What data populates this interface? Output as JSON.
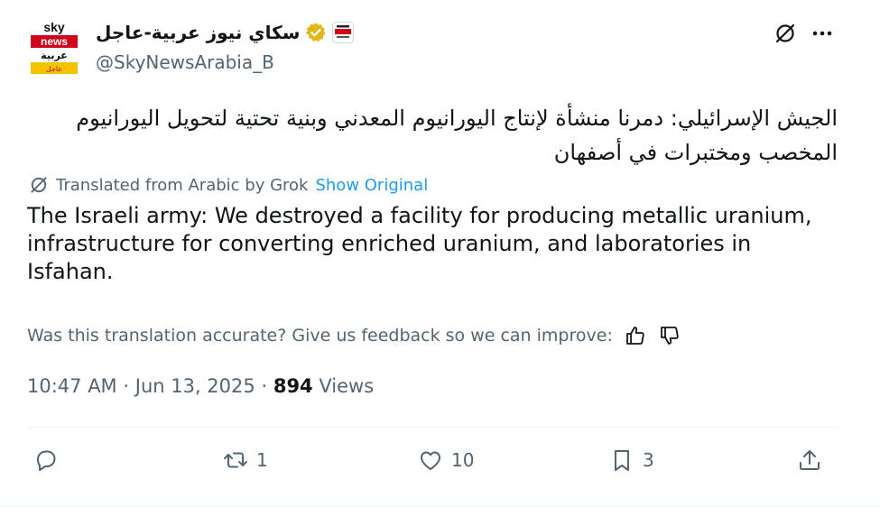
{
  "author": {
    "display_name": "سكاي نيوز عربية-عاجل",
    "handle": "@SkyNewsArabia_B",
    "avatar_logo_text": [
      "sky",
      "news",
      "عربية",
      "عاجل"
    ],
    "verified_badge": "gold-check-icon",
    "affiliate_badge": "sky-news-badge-icon"
  },
  "header_icons": {
    "grok": "grok-icon",
    "more": "more-icon"
  },
  "post": {
    "arabic_text": "الجيش الإسرائيلي: دمرنا منشأة لإنتاج اليورانيوم المعدني وبنية تحتية لتحويل اليورانيوم المخصب ومختبرات في أصفهان",
    "translated_label": "Translated from Arabic by Grok",
    "show_original": "Show Original",
    "translation": "The Israeli army: We destroyed a facility for producing metallic uranium, infrastructure for converting enriched uranium, and laboratories in Isfahan.",
    "feedback_prompt": "Was this translation accurate? Give us feedback so we can improve:",
    "time": "10:47 AM",
    "separator": "·",
    "date": "Jun 13, 2025",
    "views_count": "894",
    "views_label": "Views"
  },
  "actions": {
    "reply_count": "",
    "repost_count": "1",
    "like_count": "10",
    "bookmark_count": "3"
  },
  "colors": {
    "text": "#0f1419",
    "muted": "#536471",
    "link": "#1d9bf0",
    "verified_gold": "#e2b719",
    "brand_red": "#d0021b"
  }
}
